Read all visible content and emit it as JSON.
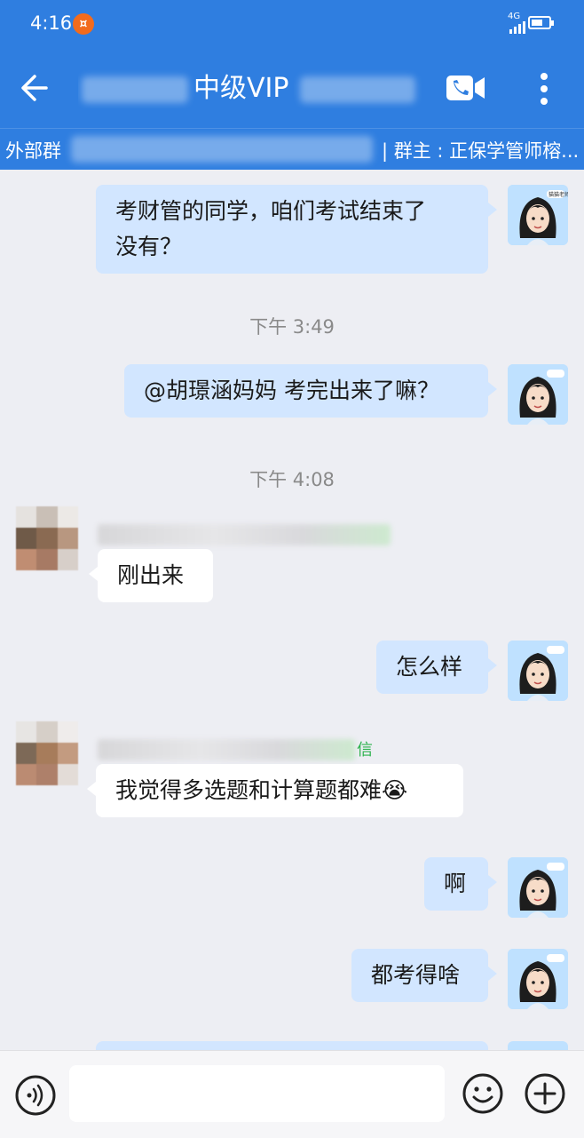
{
  "status_bar": {
    "time": "4:16",
    "notification_badge": "¤",
    "network": "4G"
  },
  "header": {
    "title": "中级VIP",
    "subtitle_tag": "外部群",
    "subtitle_owner": "| 群主 : 正保学管师榕...",
    "icons": [
      "back-arrow-icon",
      "video-call-icon",
      "more-vertical-icon"
    ]
  },
  "messages": [
    {
      "side": "self",
      "text_lines": [
        "考财管的同学，咱们考试结束了",
        "没有？"
      ]
    },
    {
      "type": "time",
      "text": "下午 3:49"
    },
    {
      "side": "self",
      "text": "@胡璟涵妈妈  考完出来了嘛？"
    },
    {
      "type": "time",
      "text": "下午 4:08"
    },
    {
      "side": "other",
      "text": "刚出来"
    },
    {
      "side": "self",
      "text": "怎么样"
    },
    {
      "side": "other",
      "text": "我觉得多选题和计算题都难",
      "sender_tag": "信",
      "emoji": "😭"
    },
    {
      "side": "self",
      "text": "啊"
    },
    {
      "side": "self",
      "text": "都考得啥"
    }
  ],
  "avatar_label": "猫猫老师",
  "colors": {
    "brand_blue": "#2f7ee0",
    "self_bubble": "#d2e6ff",
    "other_bubble": "#ffffff",
    "chat_bg": "#edeef3"
  },
  "input": {
    "placeholder": "",
    "icons": [
      "voice-icon",
      "emoji-icon",
      "plus-icon"
    ]
  }
}
